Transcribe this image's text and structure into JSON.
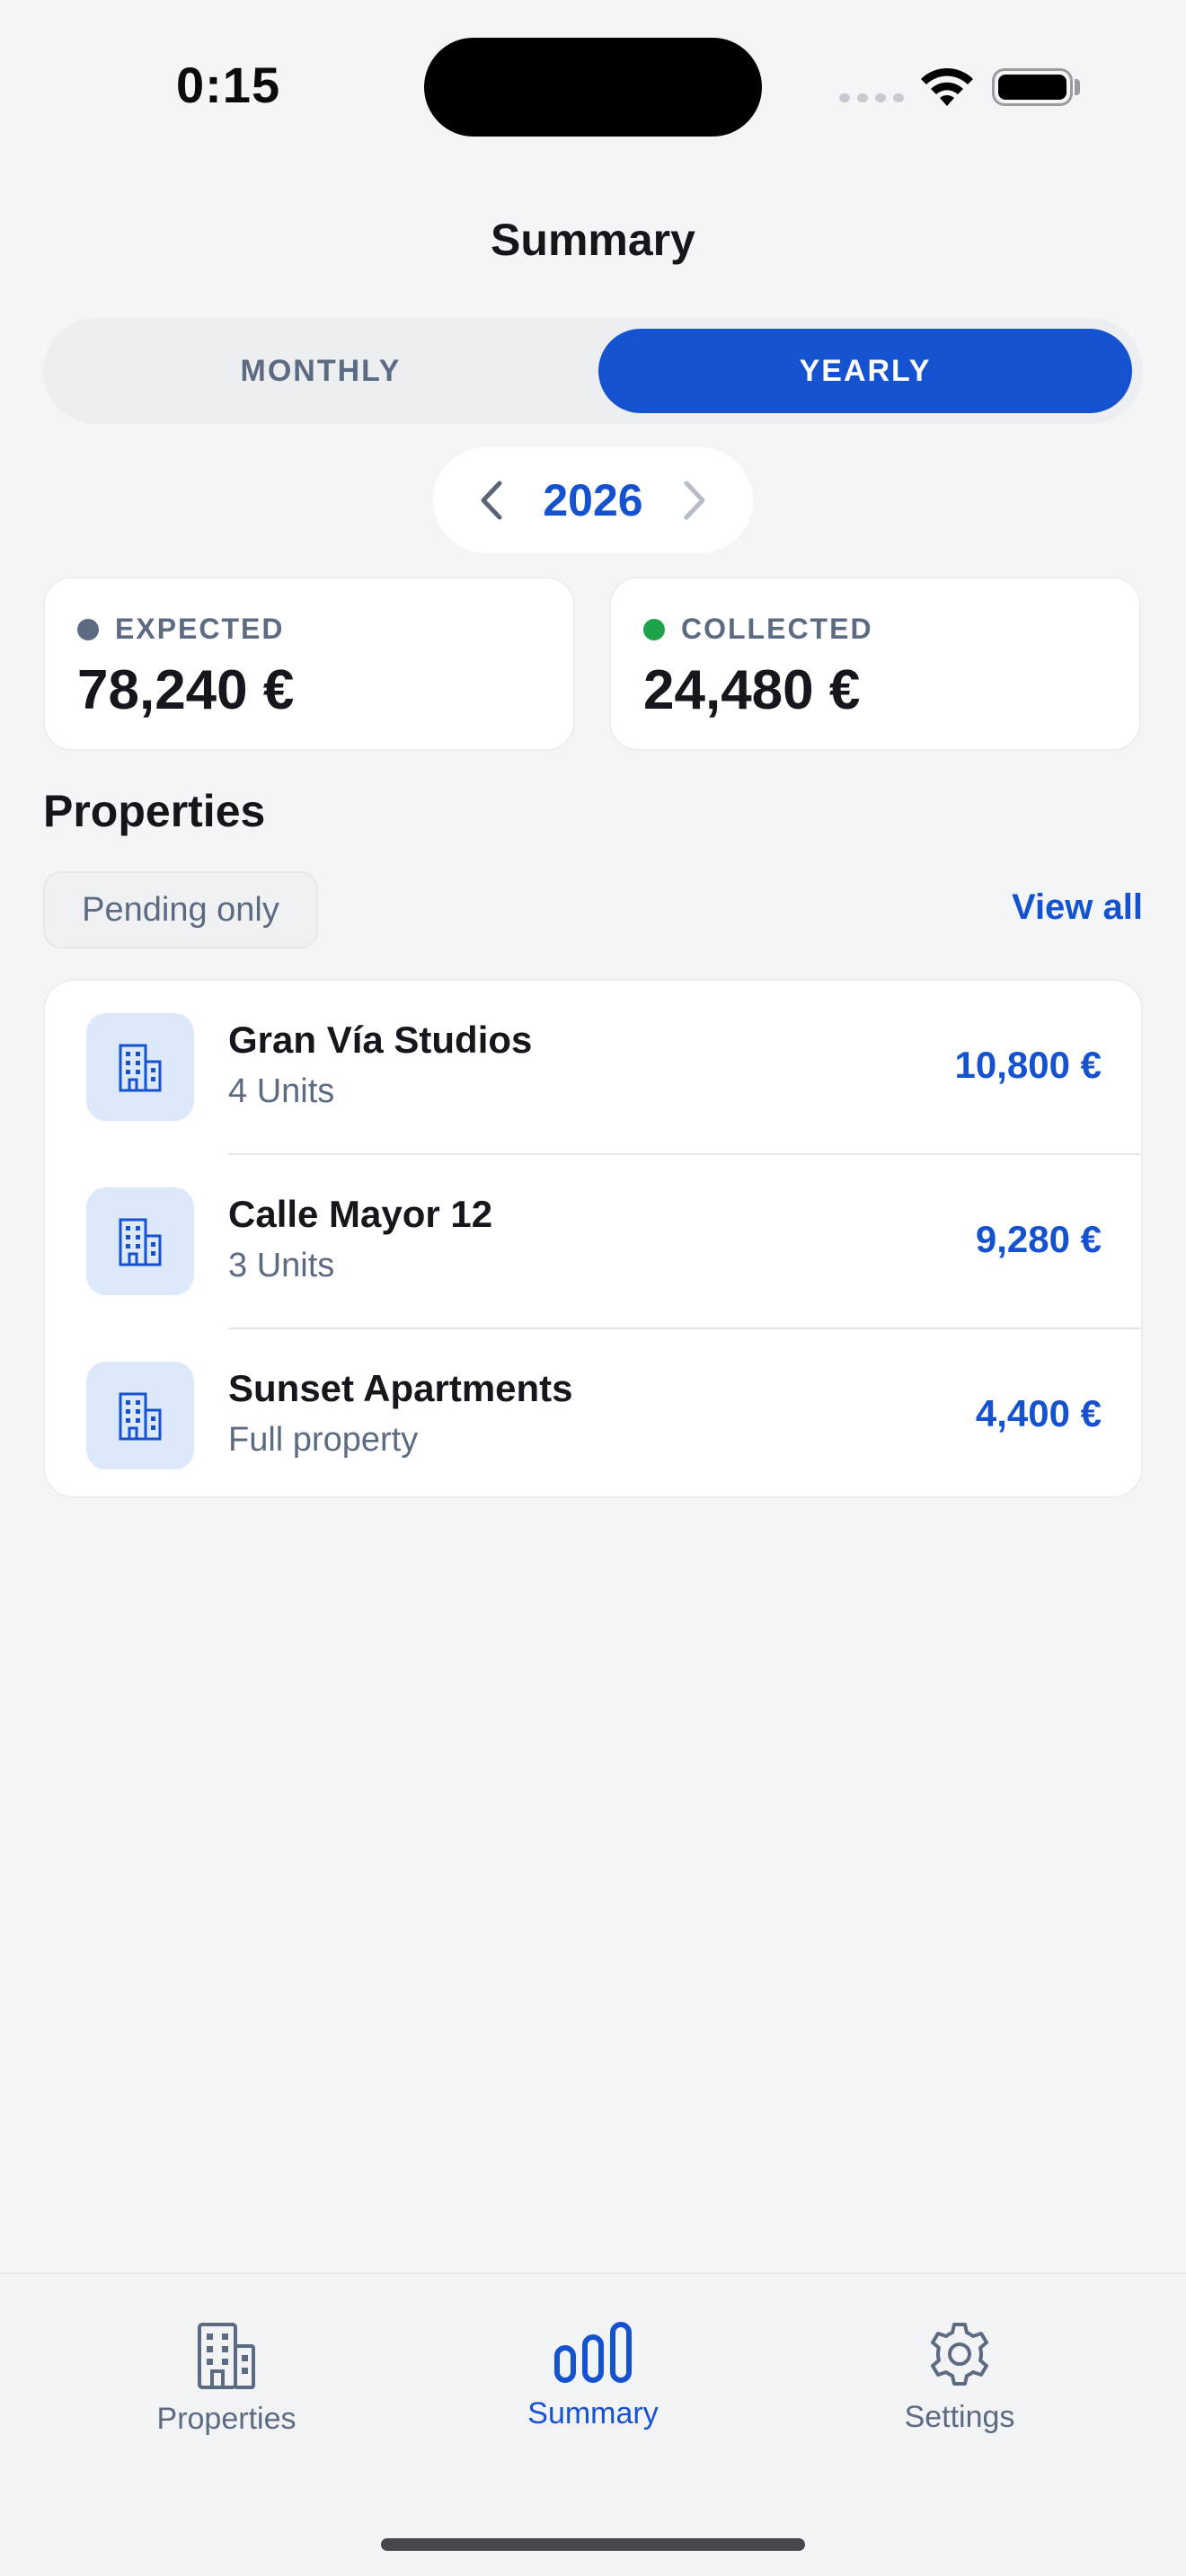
{
  "status_bar": {
    "time": "0:15"
  },
  "header": {
    "title": "Summary"
  },
  "period_toggle": {
    "monthly": "MONTHLY",
    "yearly": "YEARLY",
    "selected": "yearly"
  },
  "year_selector": {
    "year": "2026",
    "prev_icon": "chevron-left-icon",
    "next_icon": "chevron-right-icon"
  },
  "stats": {
    "expected": {
      "label": "EXPECTED",
      "value": "78,240 €",
      "dot_color": "#5d6b82"
    },
    "collected": {
      "label": "COLLECTED",
      "value": "24,480 €",
      "dot_color": "#1fa34a"
    }
  },
  "properties": {
    "title": "Properties",
    "filter_label": "Pending only",
    "view_all_label": "View all",
    "items": [
      {
        "name": "Gran Vía Studios",
        "subtitle": "4 Units",
        "amount": "10,800 €",
        "icon": "building-icon"
      },
      {
        "name": "Calle Mayor 12",
        "subtitle": "3 Units",
        "amount": "9,280 €",
        "icon": "building-icon"
      },
      {
        "name": "Sunset Apartments",
        "subtitle": "Full property",
        "amount": "4,400 €",
        "icon": "building-icon"
      }
    ]
  },
  "tab_bar": {
    "tabs": [
      {
        "label": "Properties",
        "icon": "building-icon"
      },
      {
        "label": "Summary",
        "icon": "bar-chart-icon",
        "active": true
      },
      {
        "label": "Settings",
        "icon": "gear-icon"
      }
    ]
  },
  "colors": {
    "accent": "#1552d0",
    "background": "#f4f5f7",
    "muted_text": "#5d6b82"
  }
}
